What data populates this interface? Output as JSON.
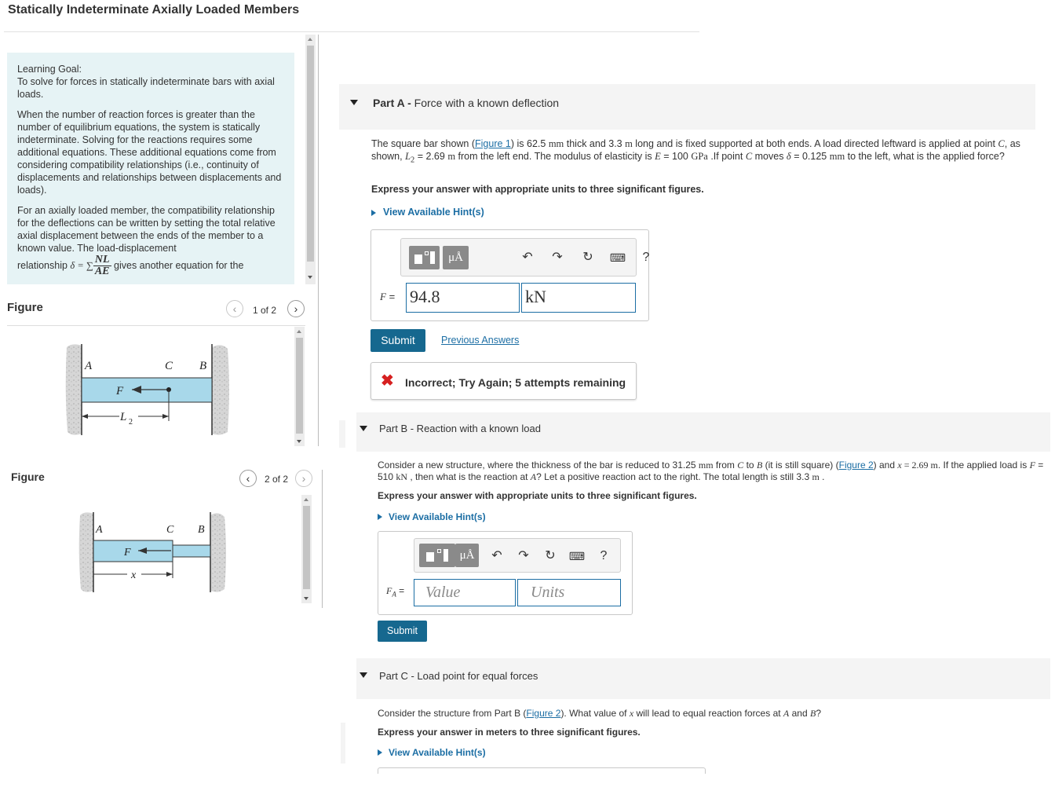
{
  "page": {
    "title": "Statically Indeterminate Axially Loaded Members"
  },
  "goal": {
    "heading": "Learning Goal:",
    "p1": "To solve for forces in statically indeterminate bars with axial loads.",
    "p2": "When the number of reaction forces is greater than the number of equilibrium equations, the system is statically indeterminate. Solving for the reactions requires some additional equations. These additional equations come from considering compatibility relationships (i.e., continuity of displacements and relationships between displacements and loads).",
    "p3": "For an axially loaded member, the compatibility relationship for the deflections can be written by setting the total relative axial displacement between the ends of the member to a known value. The load-displacement",
    "p4_pre": "relationship",
    "p4_formula_lhs": "δ = ∑",
    "p4_num": "NL",
    "p4_den": "AE",
    "p4_post": "gives another equation for the"
  },
  "figure1": {
    "label": "Figure",
    "pager": "1 of 2",
    "labels": {
      "a": "A",
      "c": "C",
      "b": "B",
      "f": "F",
      "l2": "L",
      "l2_sub": "2"
    }
  },
  "figure2": {
    "label": "Figure",
    "pager": "2 of 2",
    "labels": {
      "a": "A",
      "c": "C",
      "b": "B",
      "f": "F",
      "x": "x"
    }
  },
  "partA": {
    "label": "Part A -",
    "title": "Force with a known deflection",
    "text_1": "The square bar shown (",
    "fig_link": "Figure 1",
    "text_2": ") is 62.5 ",
    "u_mm": "mm",
    "text_3": " thick and 3.3 ",
    "u_m": "m",
    "text_4": " long and is fixed supported at both ends. A load directed leftward is applied at point ",
    "pt_c": "C",
    "text_5": ", as shown, ",
    "l2": "L",
    "l2_sub": "2",
    "text_6": " = 2.69 ",
    "text_7": " from the left end. The modulus of elasticity is ",
    "e": "E",
    "text_8": " = 100 ",
    "u_gpa": "GPa",
    "text_9": " .If point ",
    "text_10": " moves ",
    "delta": "δ",
    "text_11": " = 0.125 ",
    "text_12": " to the left, what is the applied force?",
    "express": "Express your answer with appropriate units to three significant figures.",
    "hints": "View Available Hint(s)",
    "var_label": "F",
    "eq": " =",
    "value": "94.8",
    "units": "kN",
    "submit": "Submit",
    "previous": "Previous Answers",
    "feedback": "Incorrect; Try Again; 5 attempts remaining"
  },
  "toolbar": {
    "mu": "μÅ",
    "help": "?"
  },
  "partB": {
    "label": "Part B",
    "title": " - Reaction with a known load",
    "text_1": "Consider a new structure, where the thickness of the bar is reduced to 31.25 ",
    "u_mm": "mm",
    "text_2": " from ",
    "c": "C",
    "text_3": " to ",
    "b": "B",
    "text_4": " (it is still square) (",
    "fig_link": "Figure 2",
    "text_5": ") and ",
    "x": "x",
    "text_6": " = 2.69 ",
    "u_m": "m",
    "text_7": ". If the applied load is ",
    "f": "F",
    "text_8": " = 510 ",
    "u_kn": "kN",
    "text_9": " , then what is the reaction at ",
    "a": "A",
    "text_10": "? Let a positive reaction act to the right. The total length is still 3.3 ",
    "text_11": " .",
    "express": "Express your answer with appropriate units to three significant figures.",
    "hints": "View Available Hint(s)",
    "var_label": "F",
    "var_sub": "A",
    "eq": " =",
    "value_ph": "Value",
    "units_ph": "Units",
    "submit": "Submit"
  },
  "partC": {
    "label": "Part C",
    "title": " - Load point for equal forces",
    "text_1": "Consider the structure from Part B (",
    "fig_link": "Figure 2",
    "text_2": "). What value of ",
    "x": "x",
    "text_3": " will lead to equal reaction forces at ",
    "a": "A",
    "text_4": " and ",
    "b": "B",
    "text_5": "?",
    "express": "Express your answer in meters to three significant figures.",
    "hints": "View Available Hint(s)"
  },
  "colors": {
    "accent": "#1c6ea4",
    "submit": "#16688f",
    "goal_bg": "#e6f3f5",
    "bar_fill": "#a8d8ea",
    "error": "#d62020"
  }
}
